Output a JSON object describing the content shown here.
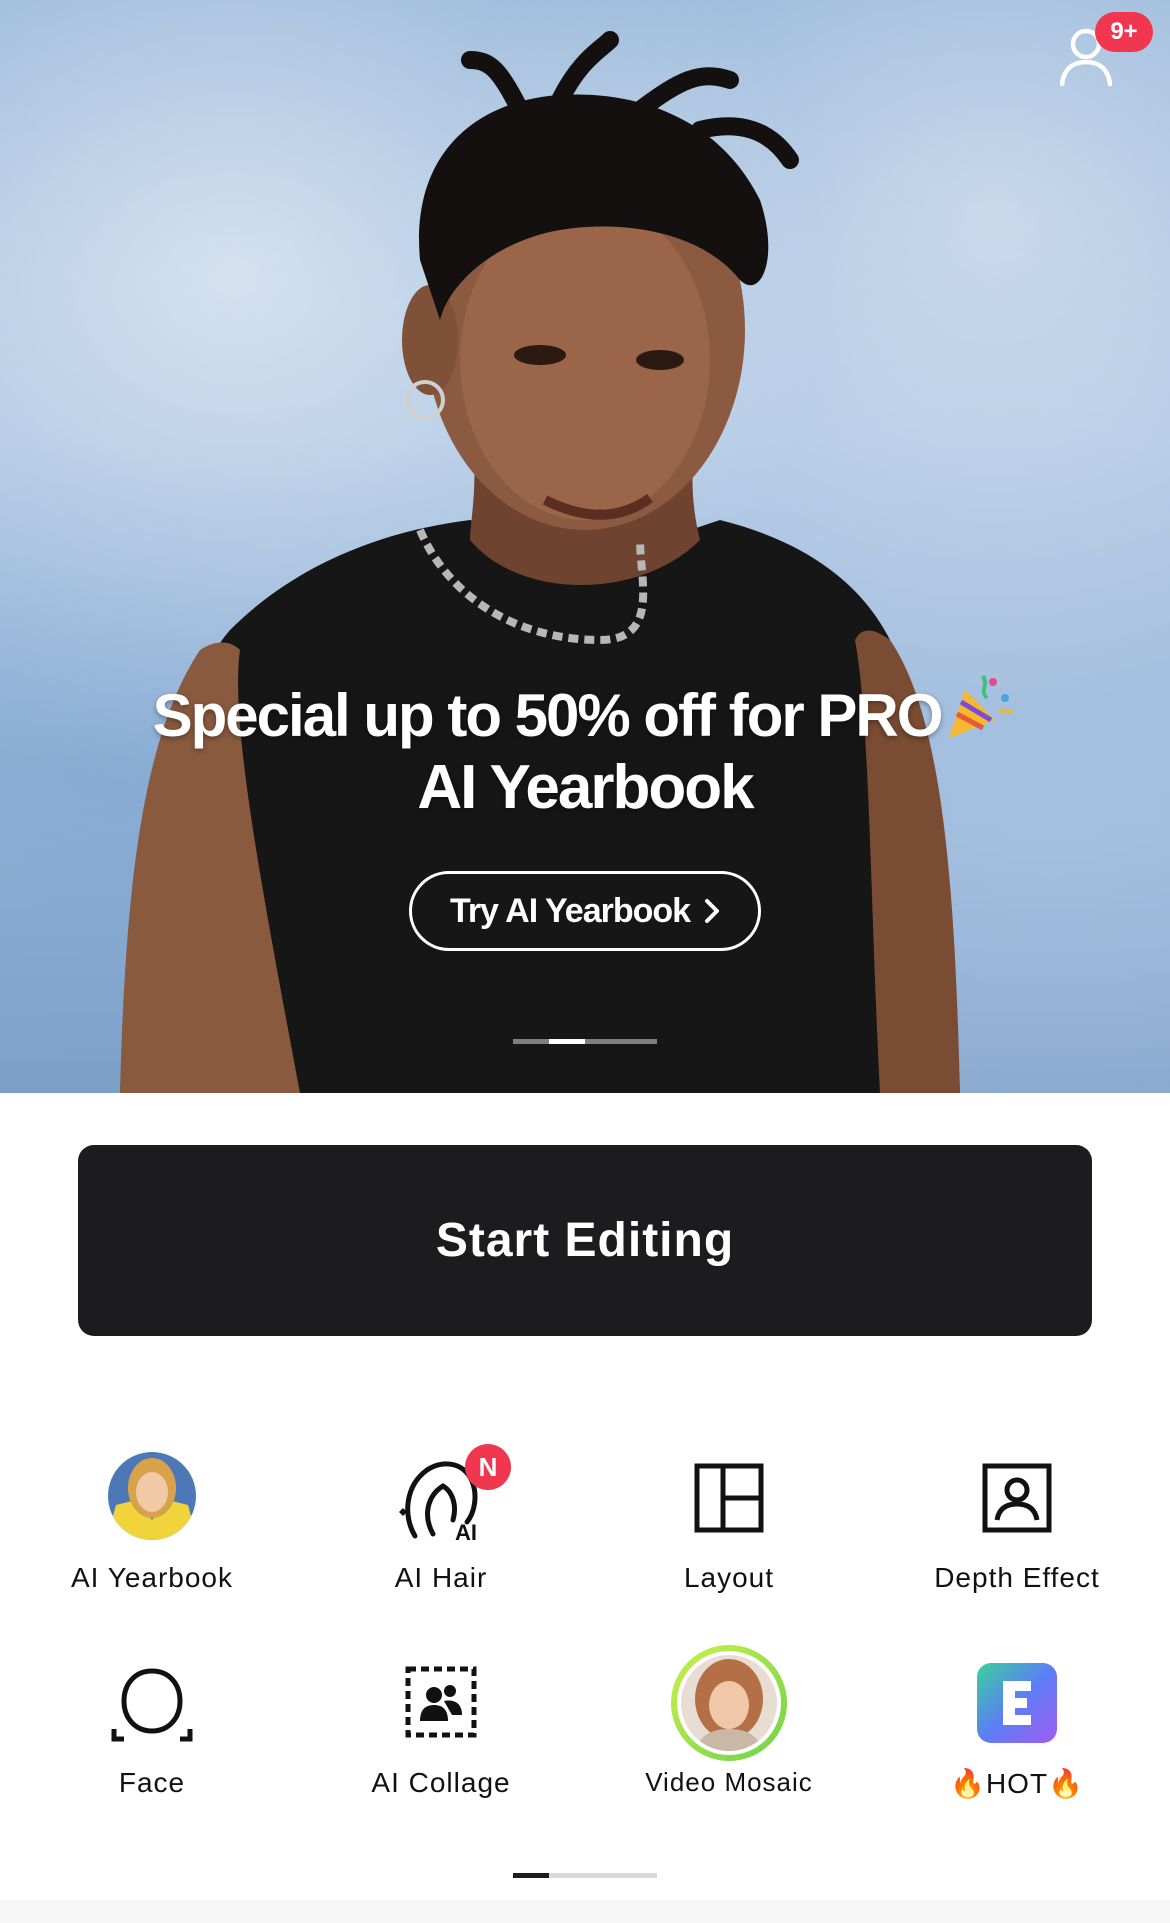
{
  "hero": {
    "promo_title": "Special up to 50% off for PRO",
    "promo_subtitle": "AI Yearbook",
    "cta_label": "Try AI Yearbook",
    "notification_count": "9+",
    "carousel": {
      "total": 4,
      "active_index": 1
    }
  },
  "main": {
    "start_editing_label": "Start Editing"
  },
  "tools": [
    {
      "label": "AI Yearbook",
      "icon": "yearbook-avatar-icon"
    },
    {
      "label": "AI Hair",
      "icon": "ai-hair-icon",
      "badge": "N"
    },
    {
      "label": "Layout",
      "icon": "layout-icon"
    },
    {
      "label": "Depth Effect",
      "icon": "depth-effect-icon"
    },
    {
      "label": "Face",
      "icon": "face-icon"
    },
    {
      "label": "AI Collage",
      "icon": "ai-collage-icon"
    },
    {
      "label": "Video Mosaic",
      "icon": "video-mosaic-avatar-icon"
    },
    {
      "label": "HOT",
      "icon": "hot-app-icon",
      "prefix": "🔥",
      "suffix": "🔥"
    }
  ],
  "tools_pagination": {
    "total": 4,
    "active_index": 0
  },
  "colors": {
    "accent_red": "#f0374f",
    "button_dark": "#1c1c1e",
    "hot_icon_gradient": [
      "#3ad39a",
      "#5b7ef5",
      "#a05cf0"
    ]
  }
}
